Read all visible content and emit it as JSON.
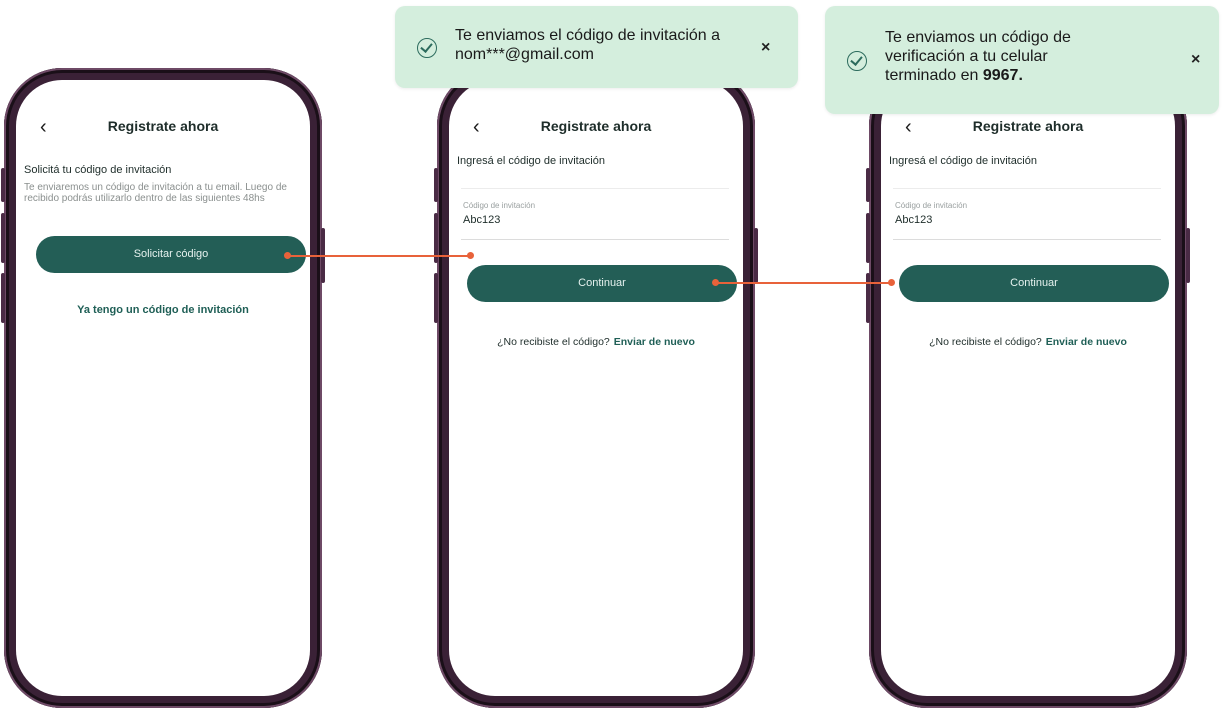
{
  "screens": [
    {
      "nav_title": "Registrate ahora",
      "back_icon": "back-chevron-icon",
      "heading": "Solicitá tu código de invitación",
      "description": "Te enviaremos un código de invitación a tu email. Luego de recibido podrás utilizarlo dentro de las siguientes 48hs",
      "primary_button": "Solicitar código",
      "secondary_link": "Ya tengo un código de invitación"
    },
    {
      "nav_title": "Registrate ahora",
      "back_icon": "back-chevron-icon",
      "heading": "Ingresá el código de invitación",
      "field_label": "Código de invitación",
      "field_value": "Abc123",
      "primary_button": "Continuar",
      "resend_prompt": "¿No recibiste el código?",
      "resend_action": "Enviar de nuevo"
    },
    {
      "nav_title": "Registrate ahora",
      "back_icon": "back-chevron-icon",
      "heading": "Ingresá el código de invitación",
      "field_label": "Código de invitación",
      "field_value": "Abc123",
      "primary_button": "Continuar",
      "resend_prompt": "¿No recibiste el código?",
      "resend_action": "Enviar de nuevo"
    }
  ],
  "toasts": [
    {
      "icon": "check-circle-icon",
      "line1": "Te enviamos el código de invitación a",
      "line2": "nom***@gmail.com",
      "close_label": "×"
    },
    {
      "icon": "check-circle-icon",
      "line1": "Te enviamos un código de",
      "line2": "verificación a tu celular",
      "line3_prefix": "terminado en",
      "line3_bold": "9967.",
      "close_label": "×"
    }
  ],
  "colors": {
    "primary": "#235e56",
    "toast_bg": "#d4eedd",
    "connector": "#e8623a",
    "phone_frame": "#3a2136"
  }
}
